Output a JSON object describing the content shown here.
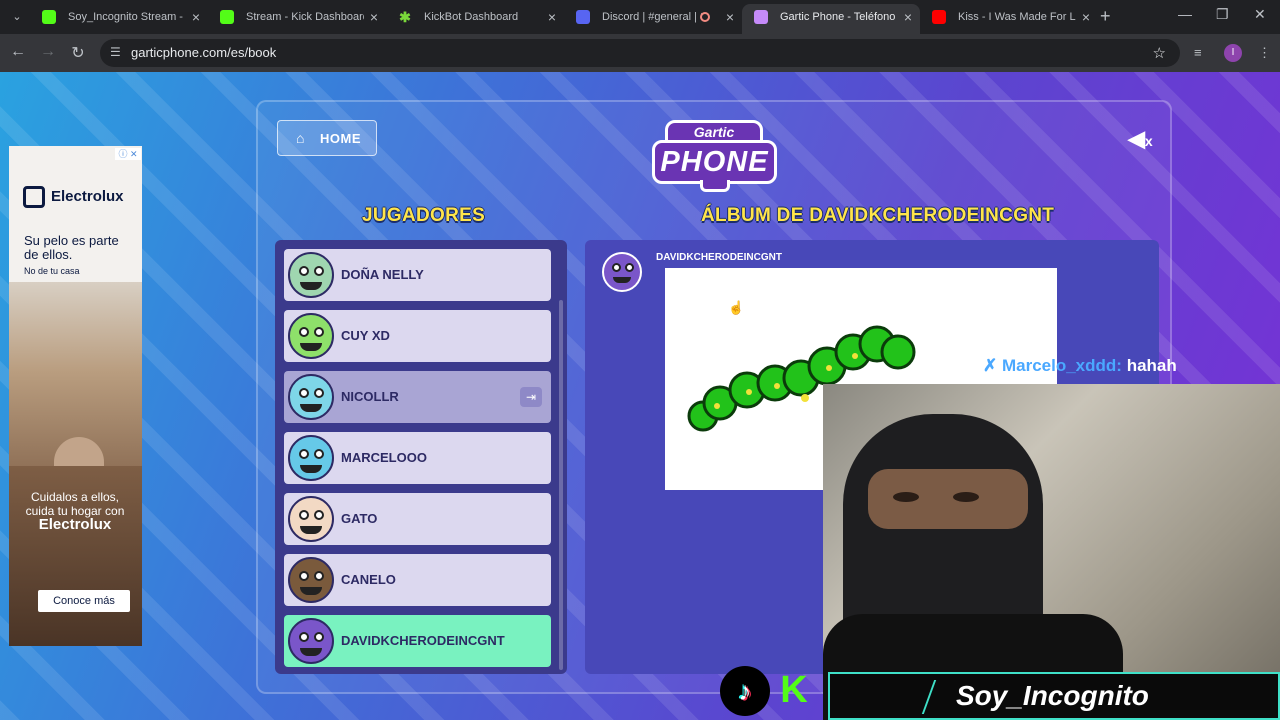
{
  "browser": {
    "tabs": [
      {
        "title": "Soy_Incognito Stream - W",
        "favicon": "kick-icon",
        "active": false
      },
      {
        "title": "Stream - Kick Dashboard",
        "favicon": "kick-icon",
        "active": false
      },
      {
        "title": "KickBot Dashboard",
        "favicon": "kickbot-icon",
        "active": false
      },
      {
        "title": "Discord | #general | Se",
        "favicon": "discord-icon",
        "active": false
      },
      {
        "title": "Gartic Phone - Teléfono De",
        "favicon": "gartic-icon",
        "active": true
      },
      {
        "title": "Kiss - I Was Made For Lovi",
        "favicon": "youtube-icon",
        "active": false
      }
    ],
    "url": "garticphone.com/es/book",
    "profile_initial": "I"
  },
  "ad": {
    "brand": "Electrolux",
    "headline": "Su pelo es parte de ellos.",
    "subline": "No de tu casa",
    "tagline": "Cuidalos a ellos, cuida tu hogar con",
    "cta": "Conoce más"
  },
  "game": {
    "home_label": "HOME",
    "logo_top": "Gartic",
    "logo_main": "PHONE",
    "mute_icon": "speaker-mute-icon",
    "mute_x": "x",
    "players_title": "JUGADORES",
    "album_title": "ÁLBUM DE DAVIDKCHERODEINCGNT",
    "players": [
      {
        "name": "DOÑA NELLY",
        "avatar_color": "#9fd6b0",
        "state": "normal"
      },
      {
        "name": "CUY XD",
        "avatar_color": "#8ee06a",
        "state": "normal"
      },
      {
        "name": "NICOLLR",
        "avatar_color": "#7ed6e8",
        "state": "faded"
      },
      {
        "name": "MARCELOOO",
        "avatar_color": "#66c9e8",
        "state": "normal"
      },
      {
        "name": "GATO",
        "avatar_color": "#f2d9c4",
        "state": "normal"
      },
      {
        "name": "CANELO",
        "avatar_color": "#7a5a3c",
        "state": "normal"
      },
      {
        "name": "DAVIDKCHERODEINCGNT",
        "avatar_color": "#7a56c9",
        "state": "current"
      }
    ],
    "album_author": "DAVIDKCHERODEINCGNT"
  },
  "stream": {
    "chat_user": "Marcelo_xddd:",
    "chat_text": "hahah",
    "streamer_name": "Soy_Incognito"
  }
}
